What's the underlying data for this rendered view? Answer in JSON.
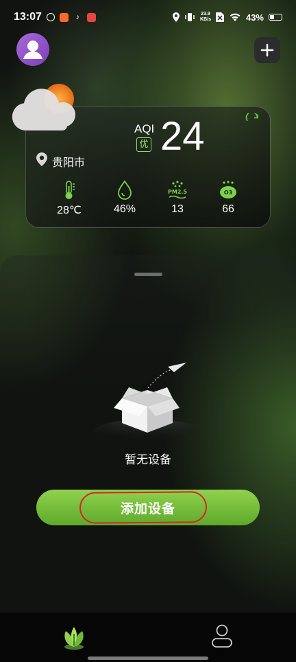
{
  "status_bar": {
    "time": "13:07",
    "net_speed_value": "23.9",
    "net_speed_unit": "KB/s",
    "battery": "43%",
    "battery_level": 0.43
  },
  "weather": {
    "aqi_label": "AQI",
    "aqi_grade": "优",
    "aqi_value": "24",
    "location": "贵阳市",
    "temperature": "28℃",
    "humidity": "46%",
    "pm25_value": "13",
    "pm25_icon_label": "PM2.5",
    "ozone_value": "66",
    "ozone_icon_label": "O3"
  },
  "devices": {
    "empty_text": "暂无设备",
    "add_button_label": "添加设备"
  },
  "colors": {
    "accent_green": "#7cc63f",
    "highlight_red": "#d8242a",
    "aqi_grade": "#a6e070"
  },
  "icons": [
    "avatar-icon",
    "plus-icon",
    "weather-partly-cloudy-icon",
    "refresh-icon",
    "location-pin-icon",
    "thermometer-icon",
    "humidity-drop-icon",
    "pm25-icon",
    "ozone-icon",
    "empty-box-icon",
    "home-leaf-icon",
    "profile-icon"
  ]
}
